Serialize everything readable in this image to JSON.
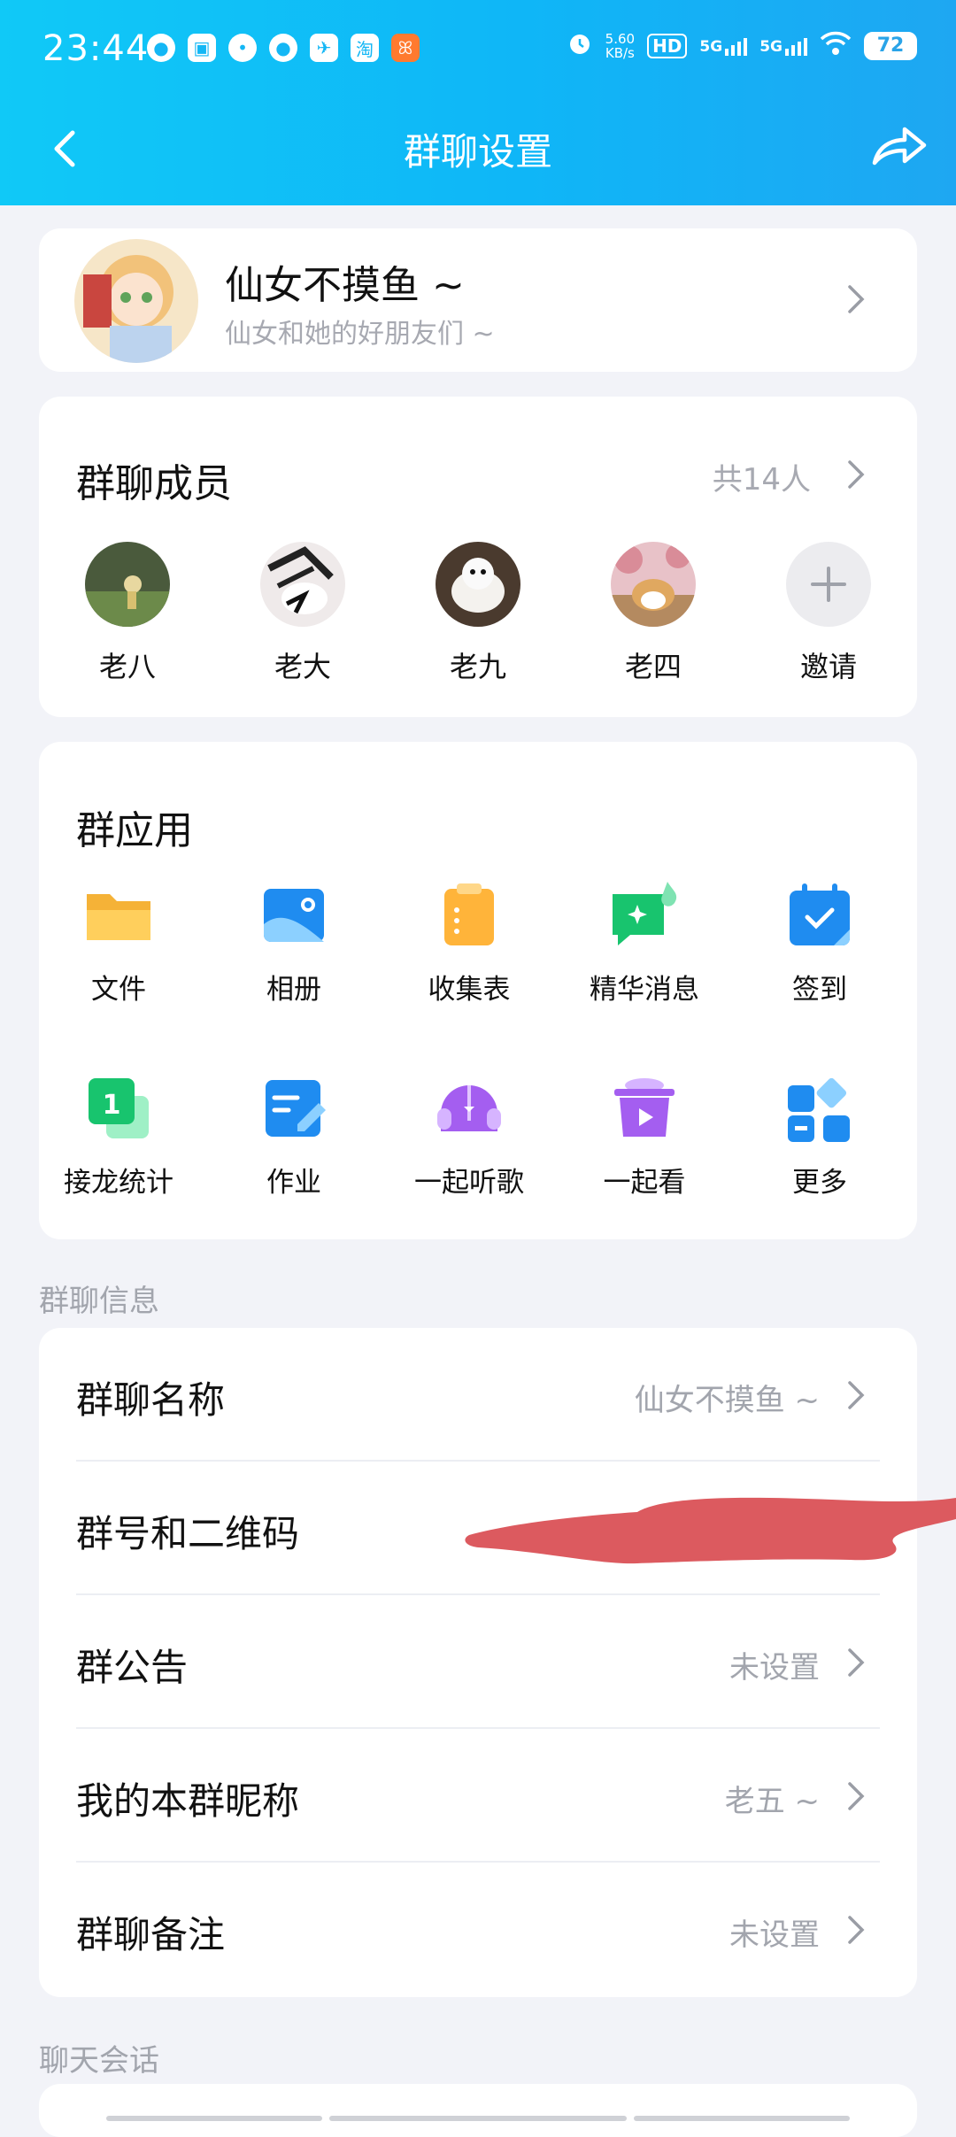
{
  "status_bar": {
    "time": "23:44",
    "net_speed_value": "5.60",
    "net_speed_unit": "KB/s",
    "hd": "HD",
    "signal1": "5G",
    "signal2": "5G",
    "battery": "72"
  },
  "nav": {
    "title": "群聊设置"
  },
  "group": {
    "name": "仙女不摸鱼 ~",
    "description": "仙女和她的好朋友们 ~"
  },
  "members": {
    "title": "群聊成员",
    "count": "共14人",
    "list": [
      {
        "name": "老八"
      },
      {
        "name": "老大"
      },
      {
        "name": "老九"
      },
      {
        "name": "老四"
      }
    ],
    "invite_label": "邀请"
  },
  "apps": {
    "title": "群应用",
    "items": [
      {
        "label": "文件",
        "icon": "folder-icon"
      },
      {
        "label": "相册",
        "icon": "album-icon"
      },
      {
        "label": "收集表",
        "icon": "clipboard-icon"
      },
      {
        "label": "精华消息",
        "icon": "highlight-message-icon"
      },
      {
        "label": "签到",
        "icon": "calendar-checkin-icon"
      },
      {
        "label": "接龙统计",
        "icon": "relay-stats-icon"
      },
      {
        "label": "作业",
        "icon": "homework-icon"
      },
      {
        "label": "一起听歌",
        "icon": "listen-together-icon"
      },
      {
        "label": "一起看",
        "icon": "watch-together-icon"
      },
      {
        "label": "更多",
        "icon": "more-apps-icon"
      }
    ]
  },
  "info": {
    "section_label": "群聊信息",
    "rows": [
      {
        "label": "群聊名称",
        "value": "仙女不摸鱼 ~"
      },
      {
        "label": "群号和二维码",
        "value": ""
      },
      {
        "label": "群公告",
        "value": "未设置"
      },
      {
        "label": "我的本群昵称",
        "value": "老五 ~"
      },
      {
        "label": "群聊备注",
        "value": "未设置"
      }
    ]
  },
  "chat": {
    "section_label": "聊天会话"
  },
  "colors": {
    "header_gradient_start": "#10c9f7",
    "header_gradient_end": "#1ea7f2",
    "background": "#f2f3f8",
    "secondary_text": "#a2a5ad",
    "redaction": "#dc5a5f"
  }
}
